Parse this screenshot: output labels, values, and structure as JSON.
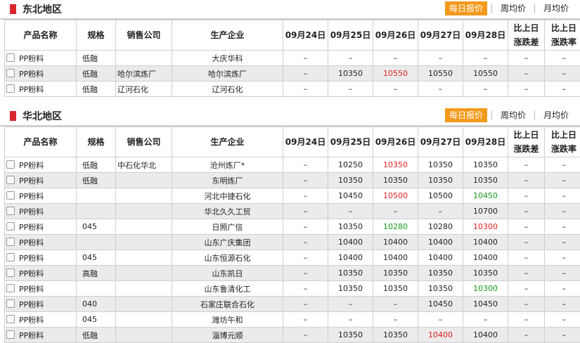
{
  "tabs": {
    "daily": "每日报价",
    "weekly": "周均价",
    "monthly": "月均价"
  },
  "headers": [
    "产品名称",
    "规格",
    "销售公司",
    "生产企业",
    "09月24日",
    "09月25日",
    "09月26日",
    "09月27日",
    "09月28日",
    "比上日涨跌差",
    "比上日涨跌率"
  ],
  "colors": {
    "accent": "#f39a1c",
    "marker": "#d9262c",
    "up": "#e02020",
    "down": "#169a1a"
  },
  "sections": [
    {
      "title": "东北地区",
      "rows": [
        {
          "product": "PP粉料",
          "spec": "低融",
          "seller": "",
          "producer": "大庆华科",
          "d24": "–",
          "d25": "–",
          "d26": "–",
          "d27": "–",
          "d28": "–",
          "diff": "–",
          "rate": "–"
        },
        {
          "product": "PP粉料",
          "spec": "低融",
          "seller": "哈尔滨炼厂",
          "producer": "哈尔滨炼厂",
          "d24": "–",
          "d25": "10350",
          "d26": "10550",
          "d26c": "red",
          "d27": "10550",
          "d28": "10550",
          "diff": "–",
          "rate": "–"
        },
        {
          "product": "PP粉料",
          "spec": "低融",
          "seller": "辽河石化",
          "producer": "辽河石化",
          "d24": "–",
          "d25": "–",
          "d26": "–",
          "d27": "–",
          "d28": "–",
          "diff": "–",
          "rate": "–"
        }
      ]
    },
    {
      "title": "华北地区",
      "rows": [
        {
          "product": "PP粉料",
          "spec": "低融",
          "seller": "中石化华北",
          "producer": "沧州炼厂*",
          "d24": "–",
          "d25": "10250",
          "d26": "10350",
          "d26c": "red",
          "d27": "10350",
          "d28": "10350",
          "diff": "–",
          "rate": "–"
        },
        {
          "product": "PP粉料",
          "spec": "低融",
          "seller": "",
          "producer": "东明炼厂",
          "d24": "–",
          "d25": "10350",
          "d26": "10350",
          "d27": "10350",
          "d28": "10350",
          "diff": "–",
          "rate": "–"
        },
        {
          "product": "PP粉料",
          "spec": "",
          "seller": "",
          "producer": "河北中捷石化",
          "d24": "–",
          "d25": "10450",
          "d26": "10500",
          "d26c": "red",
          "d27": "10500",
          "d28": "10450",
          "d28c": "green",
          "diff": "–",
          "rate": "–"
        },
        {
          "product": "PP粉料",
          "spec": "",
          "seller": "",
          "producer": "华北久久工贸",
          "d24": "–",
          "d25": "–",
          "d26": "–",
          "d27": "–",
          "d28": "10700",
          "diff": "–",
          "rate": "–"
        },
        {
          "product": "PP粉料",
          "spec": "045",
          "seller": "",
          "producer": "日照广信",
          "d24": "–",
          "d25": "10350",
          "d26": "10280",
          "d26c": "green",
          "d27": "10280",
          "d28": "10300",
          "d28c": "red",
          "diff": "–",
          "rate": "–"
        },
        {
          "product": "PP粉料",
          "spec": "",
          "seller": "",
          "producer": "山东广庆集团",
          "d24": "–",
          "d25": "10400",
          "d26": "10400",
          "d27": "10400",
          "d28": "10400",
          "diff": "–",
          "rate": "–"
        },
        {
          "product": "PP粉料",
          "spec": "045",
          "seller": "",
          "producer": "山东恒源石化",
          "d24": "–",
          "d25": "10400",
          "d26": "10400",
          "d27": "10400",
          "d28": "10400",
          "diff": "–",
          "rate": "–"
        },
        {
          "product": "PP粉料",
          "spec": "高融",
          "seller": "",
          "producer": "山东凯日",
          "d24": "–",
          "d25": "10350",
          "d26": "10350",
          "d27": "10350",
          "d28": "10350",
          "diff": "–",
          "rate": "–"
        },
        {
          "product": "PP粉料",
          "spec": "",
          "seller": "",
          "producer": "山东鲁清化工",
          "d24": "–",
          "d25": "10350",
          "d26": "10350",
          "d27": "10350",
          "d28": "10300",
          "d28c": "green",
          "diff": "–",
          "rate": "–"
        },
        {
          "product": "PP粉料",
          "spec": "040",
          "seller": "",
          "producer": "石家庄联合石化",
          "d24": "–",
          "d25": "–",
          "d26": "–",
          "d27": "10450",
          "d28": "10450",
          "diff": "–",
          "rate": "–"
        },
        {
          "product": "PP粉料",
          "spec": "045",
          "seller": "",
          "producer": "潍坊午和",
          "d24": "–",
          "d25": "–",
          "d26": "–",
          "d27": "–",
          "d28": "–",
          "diff": "–",
          "rate": "–"
        },
        {
          "product": "PP粉料",
          "spec": "低融",
          "seller": "",
          "producer": "淄博元顺",
          "d24": "–",
          "d25": "10350",
          "d26": "10350",
          "d27": "10400",
          "d27c": "red",
          "d28": "10400",
          "diff": "–",
          "rate": "–"
        }
      ]
    }
  ]
}
